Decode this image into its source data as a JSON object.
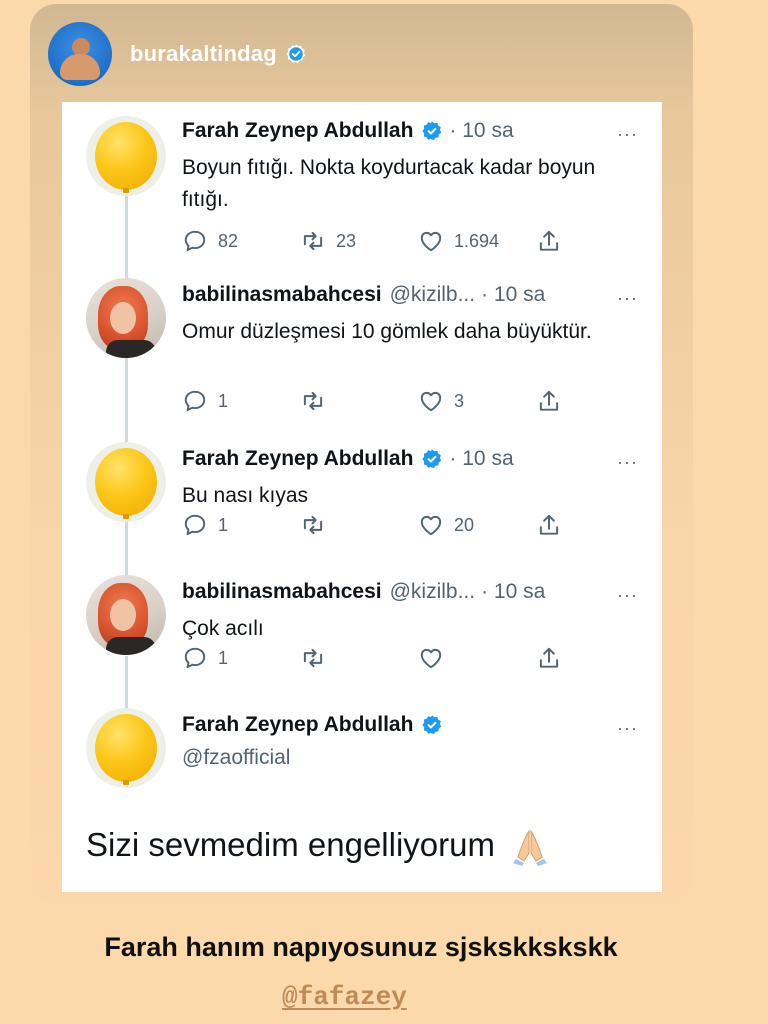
{
  "story": {
    "username": "burakaltindag",
    "caption": "Farah hanım napıyosunuz sjskskkskskk",
    "mention": "@fafazey"
  },
  "colors": {
    "background": "#fcd9ab",
    "verified": "#1d9bf0",
    "tweet_text": "#0f1419",
    "secondary_text": "#536471",
    "mention": "#c08a56"
  },
  "tweets": [
    {
      "name": "Farah Zeynep Abdullah",
      "verified": true,
      "handle": "",
      "time": "· 10 sa",
      "more": "···",
      "text": "Boyun fıtığı. Nokta koydurtacak kadar boyun fıtığı.",
      "avatar": "yellow-balloon",
      "replies": "82",
      "retweets": "23",
      "likes": "1.694"
    },
    {
      "name": "babilinasmabahcesi",
      "verified": false,
      "handle": "@kizilb...",
      "time": "· 10 sa",
      "more": "···",
      "text": "Omur düzleşmesi 10 gömlek daha büyüktür.",
      "avatar": "red-haired-woman",
      "replies": "1",
      "retweets": "",
      "likes": "3"
    },
    {
      "name": "Farah Zeynep Abdullah",
      "verified": true,
      "handle": "",
      "time": "· 10 sa",
      "more": "···",
      "text": "Bu nası kıyas",
      "avatar": "yellow-balloon",
      "replies": "1",
      "retweets": "",
      "likes": "20"
    },
    {
      "name": "babilinasmabahcesi",
      "verified": false,
      "handle": "@kizilb...",
      "time": "· 10 sa",
      "more": "···",
      "text": "Çok acılı",
      "avatar": "red-haired-woman",
      "replies": "1",
      "retweets": "",
      "likes": ""
    },
    {
      "name": "Farah Zeynep Abdullah",
      "verified": true,
      "handle": "@fzaofficial",
      "time": "",
      "more": "···",
      "text": "Sizi sevmedim engelliyorum",
      "avatar": "yellow-balloon",
      "emoji": "folded-hands-icon"
    }
  ]
}
